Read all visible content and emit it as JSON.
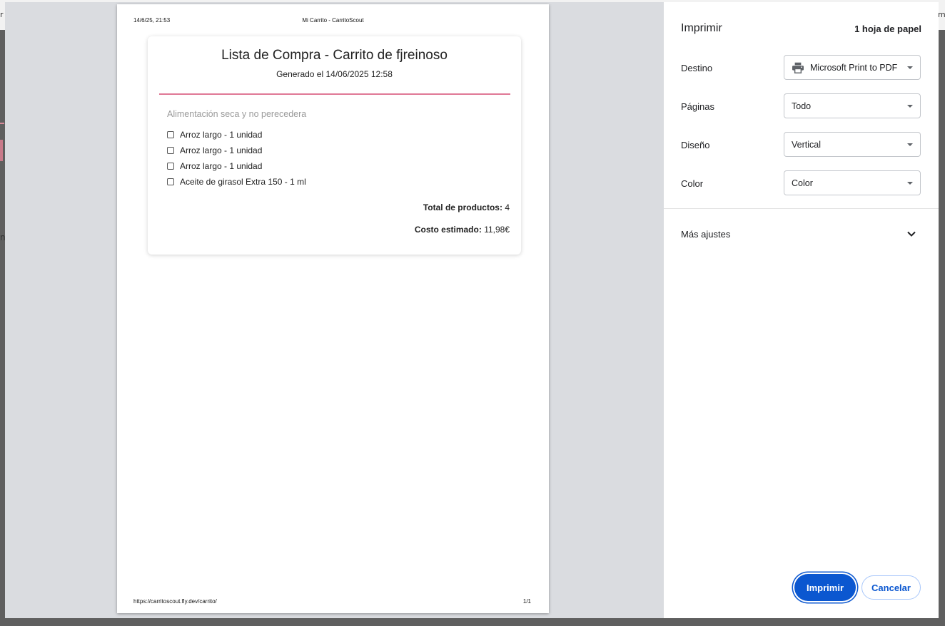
{
  "colors": {
    "accent": "#0b57d0",
    "rule": "#e07896",
    "preview_bg": "#dadce0"
  },
  "underlay": {
    "left_glyph": "r",
    "right_glyph": "me",
    "mid_glyph": "n"
  },
  "preview": {
    "header_date": "14/6/25, 21:53",
    "header_title": "Mi Carrito - CarritoScout",
    "footer_url": "https://carritoscout.fly.dev/carrito/",
    "footer_page": "1/1",
    "card": {
      "title": "Lista de Compra - Carrito de fjreinoso",
      "subtitle": "Generado el 14/06/2025 12:58",
      "category": "Alimentación seca y no perecedera",
      "items": [
        {
          "label": "Arroz largo - 1 unidad"
        },
        {
          "label": "Arroz largo - 1 unidad"
        },
        {
          "label": "Arroz largo - 1 unidad"
        },
        {
          "label": "Aceite de girasol Extra 150 - 1 ml"
        }
      ],
      "total_label": "Total de productos:",
      "total_value": "4",
      "cost_label": "Costo estimado:",
      "cost_value": "11,98€"
    }
  },
  "panel": {
    "title": "Imprimir",
    "sheets": "1 hoja de papel",
    "destination": {
      "label": "Destino",
      "value": "Microsoft Print to PDF",
      "icon": "printer-icon"
    },
    "pages": {
      "label": "Páginas",
      "value": "Todo"
    },
    "layout": {
      "label": "Diseño",
      "value": "Vertical"
    },
    "color": {
      "label": "Color",
      "value": "Color"
    },
    "more_settings": {
      "label": "Más ajustes",
      "icon": "chevron-down-icon"
    },
    "print_button": "Imprimir",
    "cancel_button": "Cancelar"
  }
}
